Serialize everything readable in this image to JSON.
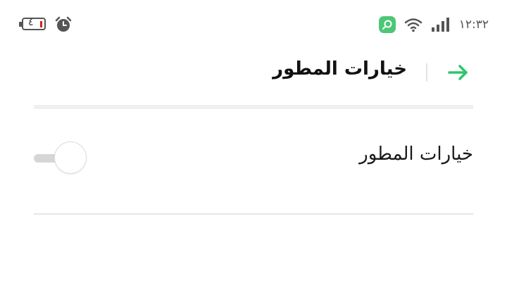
{
  "status_bar": {
    "battery_level": "٤",
    "battery_icon": "battery-icon",
    "alarm_icon": "alarm-icon",
    "app_icon": "app-notification-icon",
    "wifi_icon": "wifi-icon",
    "signal_icon": "cellular-signal-icon",
    "time": "١٢:٣٢"
  },
  "header": {
    "title": "خيارات المطور",
    "back_icon": "arrow-back-icon"
  },
  "settings": [
    {
      "label": "خيارات المطور",
      "enabled": false
    }
  ],
  "colors": {
    "accent": "#2ec56a",
    "toggle_track_off": "#d6d6d6",
    "battery_low": "#d32020",
    "app_icon_bg": "#4cc777"
  }
}
